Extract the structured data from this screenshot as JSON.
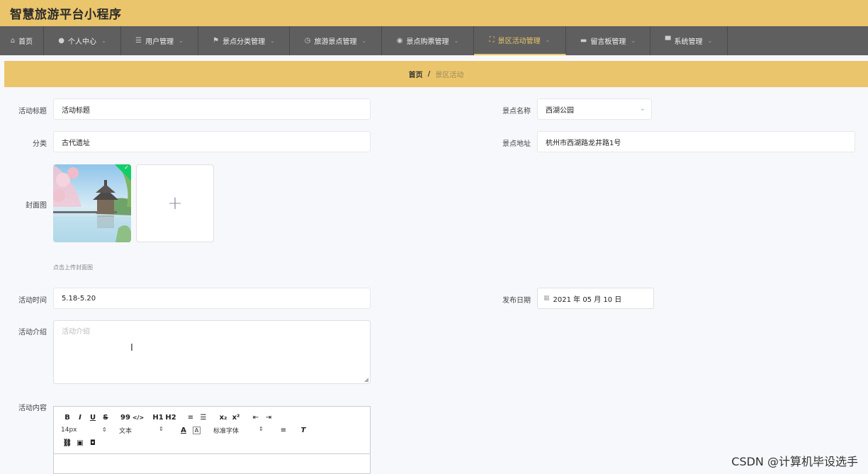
{
  "app": {
    "title": "智慧旅游平台小程序"
  },
  "colors": {
    "accent": "#ebc56b",
    "nav_bg": "#5f5f5f",
    "success": "#13ce66"
  },
  "nav": {
    "items": [
      {
        "label": "首页",
        "icon": "home-icon",
        "has_caret": false,
        "active": false
      },
      {
        "label": "个人中心",
        "icon": "user-icon",
        "has_caret": true,
        "active": false
      },
      {
        "label": "用户管理",
        "icon": "list-icon",
        "has_caret": true,
        "active": false
      },
      {
        "label": "景点分类管理",
        "icon": "flag-icon",
        "has_caret": true,
        "active": false
      },
      {
        "label": "旅游景点管理",
        "icon": "clock-icon",
        "has_caret": true,
        "active": false
      },
      {
        "label": "景点购票管理",
        "icon": "compass-icon",
        "has_caret": true,
        "active": false
      },
      {
        "label": "景区活动管理",
        "icon": "fullscreen-icon",
        "has_caret": true,
        "active": true
      },
      {
        "label": "留言板管理",
        "icon": "inbox-icon",
        "has_caret": true,
        "active": false
      },
      {
        "label": "系统管理",
        "icon": "monitor-icon",
        "has_caret": true,
        "active": false
      }
    ]
  },
  "breadcrumb": {
    "home": "首页",
    "separator": "/",
    "current": "景区活动"
  },
  "form": {
    "title": {
      "label": "活动标题",
      "value": "活动标题"
    },
    "spot_name": {
      "label": "景点名称",
      "value": "西湖公园"
    },
    "category": {
      "label": "分类",
      "value": "古代遗址"
    },
    "address": {
      "label": "景点地址",
      "value": "杭州市西湖路龙井路1号"
    },
    "cover": {
      "label": "封面图",
      "tip": "点击上传封面图",
      "add_symbol": "+"
    },
    "time": {
      "label": "活动时间",
      "value": "5.18-5.20"
    },
    "publish_date": {
      "label": "发布日期",
      "value": "2021 年 05 月 10 日"
    },
    "intro": {
      "label": "活动介绍",
      "placeholder": "活动介绍"
    },
    "content": {
      "label": "活动内容"
    }
  },
  "editor": {
    "row1": [
      "B",
      "I",
      "U",
      "S",
      "99",
      "</>",
      "H1",
      "H2",
      "≡",
      "☰",
      "x₂",
      "x²",
      "⇤",
      "⇥"
    ],
    "font_size": "14px",
    "text_style": "文本",
    "font_family": "标准字体"
  },
  "watermark": "CSDN @计算机毕设选手"
}
